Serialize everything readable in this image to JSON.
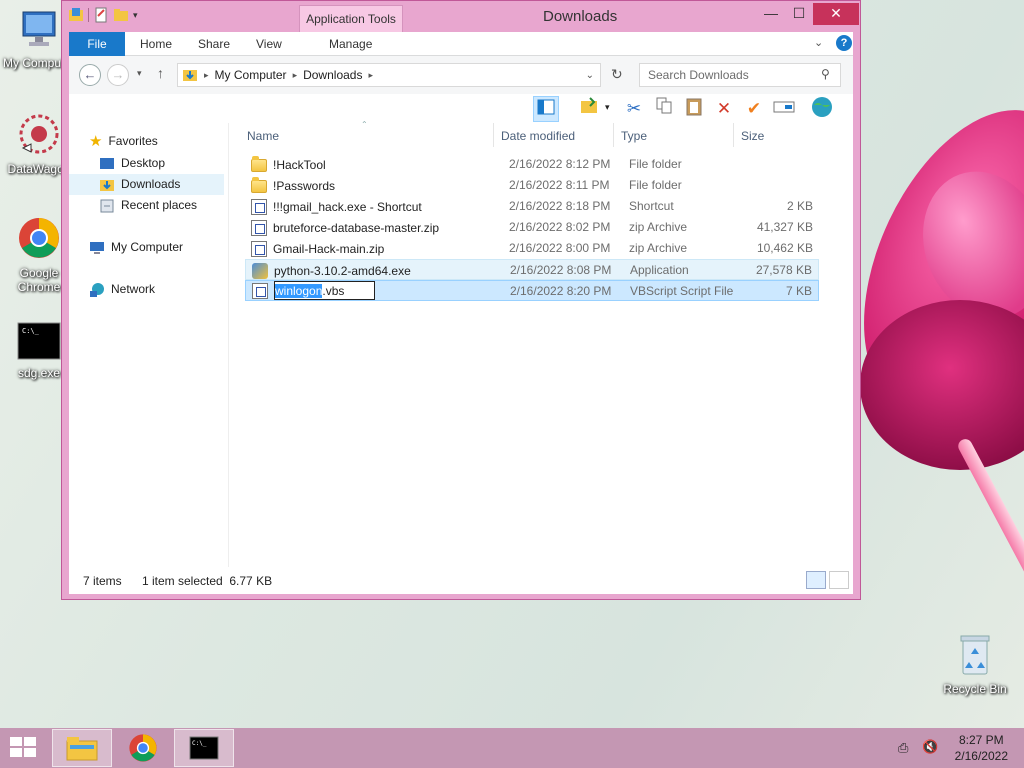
{
  "desktop": {
    "icons": [
      {
        "label": "My Computer",
        "icon": "my-computer-icon"
      },
      {
        "label": "DataWagon",
        "icon": "datawagon-icon"
      },
      {
        "label": "Google Chrome",
        "icon": "chrome-icon"
      },
      {
        "label": "sdg.exe",
        "icon": "console-icon"
      },
      {
        "label": "Recycle Bin",
        "icon": "recycle-bin-icon"
      }
    ]
  },
  "window": {
    "title": "Downloads",
    "app_tools": "Application Tools",
    "controls": {
      "minimize": "—",
      "maximize": "☐",
      "close": "✕"
    },
    "ribbon_tabs": [
      "File",
      "Home",
      "Share",
      "View",
      "Manage"
    ],
    "address": {
      "root": "My Computer",
      "current": "Downloads"
    },
    "search": {
      "placeholder": "Search Downloads"
    },
    "nav": {
      "favorites": "Favorites",
      "desktop": "Desktop",
      "downloads": "Downloads",
      "recent": "Recent places",
      "computer": "My Computer",
      "network": "Network"
    },
    "columns": {
      "name": "Name",
      "date": "Date modified",
      "type": "Type",
      "size": "Size"
    },
    "files": [
      {
        "name": "!HackTool",
        "date": "2/16/2022 8:12 PM",
        "type": "File folder",
        "size": "",
        "icon": "folder"
      },
      {
        "name": "!Passwords",
        "date": "2/16/2022 8:11 PM",
        "type": "File folder",
        "size": "",
        "icon": "folder"
      },
      {
        "name": "!!!gmail_hack.exe - Shortcut",
        "date": "2/16/2022 8:18 PM",
        "type": "Shortcut",
        "size": "2 KB",
        "icon": "shortcut"
      },
      {
        "name": "bruteforce-database-master.zip",
        "date": "2/16/2022 8:02 PM",
        "type": "zip Archive",
        "size": "41,327 KB",
        "icon": "zip"
      },
      {
        "name": "Gmail-Hack-main.zip",
        "date": "2/16/2022 8:00 PM",
        "type": "zip Archive",
        "size": "10,462 KB",
        "icon": "zip"
      },
      {
        "name": "python-3.10.2-amd64.exe",
        "date": "2/16/2022 8:08 PM",
        "type": "Application",
        "size": "27,578 KB",
        "icon": "exe"
      },
      {
        "name_selected": "winlogon",
        "name_rest": ".vbs",
        "date": "2/16/2022 8:20 PM",
        "type": "VBScript Script File",
        "size": "7 KB",
        "icon": "vbs"
      }
    ],
    "status": {
      "count": "7 items",
      "selection": "1 item selected  6.77 KB"
    }
  },
  "taskbar": {
    "clock_time": "8:27 PM",
    "clock_date": "2/16/2022"
  },
  "colors": {
    "accent": "#1979ca",
    "window_frame": "#e8a6cf",
    "taskbar": "#c497b3",
    "close": "#c7325b"
  }
}
